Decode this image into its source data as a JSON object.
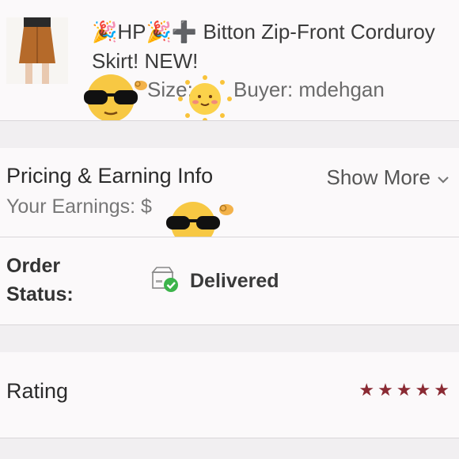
{
  "item": {
    "title": "🎉HP🎉➕ Bitton Zip-Front Corduroy Skirt! NEW!",
    "size_label": "Size:",
    "buyer": "Buyer: mdehgan"
  },
  "pricing": {
    "title": "Pricing & Earning Info",
    "show_more": "Show More",
    "earnings_label": "Your Earnings: $"
  },
  "order": {
    "label": "Order Status:",
    "status": "Delivered",
    "status_color": "#3cb44b"
  },
  "rating": {
    "label": "Rating",
    "stars": 5,
    "star_color": "#8a2a33"
  },
  "icons": [
    "sunglasses-emoji-icon",
    "sun-emoji-icon",
    "package-delivered-icon",
    "chevron-down-icon",
    "star-icon"
  ]
}
